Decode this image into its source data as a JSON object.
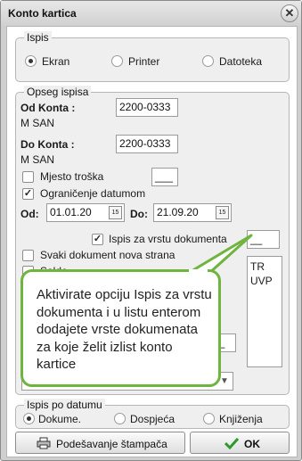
{
  "window": {
    "title": "Konto kartica"
  },
  "ispis": {
    "title": "Ispis",
    "options": [
      {
        "label": "Ekran",
        "selected": true
      },
      {
        "label": "Printer",
        "selected": false
      },
      {
        "label": "Datoteka",
        "selected": false
      }
    ]
  },
  "opseg": {
    "title": "Opseg ispisa",
    "od_konta": {
      "label": "Od Konta :",
      "value": "2200-0333",
      "desc": "M SAN"
    },
    "do_konta": {
      "label": "Do Konta :",
      "value": "2200-0333",
      "desc": "M SAN"
    },
    "mjesto_troska": {
      "label": "Mjesto troška",
      "checked": false,
      "value": "___"
    },
    "ogranicenje": {
      "label": "Ograničenje datumom",
      "checked": true
    },
    "od": {
      "label": "Od:",
      "value": "01.01.20"
    },
    "do": {
      "label": "Do:",
      "value": "21.09.20"
    },
    "vrsta": {
      "label": "Ispis za  vrstu dokumenta",
      "checked": true,
      "value": "__"
    },
    "vrsta_list": [
      "TR",
      "UVP"
    ],
    "svaki_dokument": {
      "label": "Svaki dokument nova strana",
      "checked": false
    },
    "saldo": {
      "label": "Saldo",
      "checked": false
    },
    "small_field": "0_"
  },
  "callout": {
    "text": "Aktivirate opciju Ispis za vrstu dokumenta i u listu enterom dodajete vrste dokumenata za koje želit izlist konto kartice"
  },
  "datum": {
    "title": "Ispis po datumu",
    "options": [
      {
        "label": "Dokume.",
        "selected": true
      },
      {
        "label": "Dospjeća",
        "selected": false
      },
      {
        "label": "Knjiženja",
        "selected": false
      }
    ]
  },
  "buttons": {
    "settings": "Podešavanje štampača",
    "ok": "OK"
  },
  "colors": {
    "accent": "#6fb43f",
    "ok_check": "#2e9a2e"
  }
}
